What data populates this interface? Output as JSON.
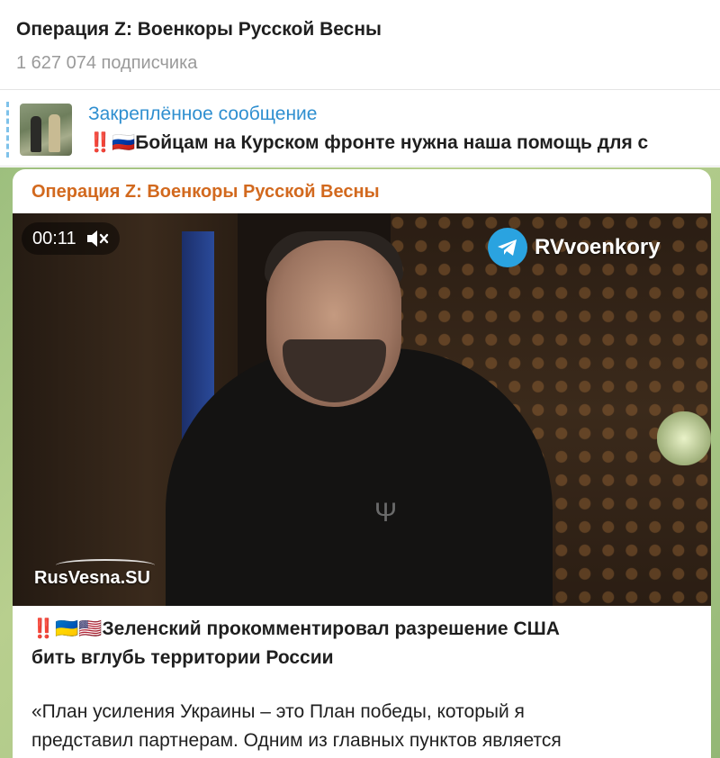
{
  "header": {
    "title": "Операция Z: Военкоры Русской Весны",
    "subscribers": "1 627 074 подписчика"
  },
  "pinned": {
    "title": "Закреплённое сообщение",
    "text": "‼️🇷🇺Бойцам на Курском фронте нужна наша помощь для с"
  },
  "message": {
    "author": "Операция Z: Военкоры Русской Весны",
    "video": {
      "duration": "00:11",
      "channel_logo": "RVvoenkory",
      "watermark": "RusVesna.SU",
      "logo_icon": "telegram-icon",
      "mute_icon": "speaker-muted-icon"
    },
    "headline_line1": "‼️🇺🇦🇺🇸Зеленский прокомментировал разрешение США",
    "headline_line2": "бить вглубь территории России",
    "body_line1": "«План усиления Украины – это План победы, который я",
    "body_line2": "представил партнерам. Одним из главных пунктов является"
  },
  "colors": {
    "accent": "#2f8fd0",
    "author": "#d2691e",
    "chat_background": "#a9c686"
  }
}
